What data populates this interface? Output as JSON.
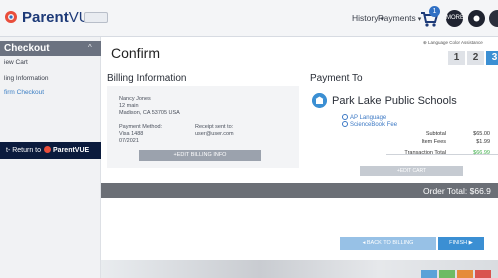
{
  "header": {
    "logo_bold": "Parent",
    "logo_light": "VUE",
    "nav": [
      {
        "label": "History"
      },
      {
        "label": "Payments"
      }
    ],
    "cart_count": "1",
    "nav_caret": "▾",
    "round_btn_label": "MORE"
  },
  "sidebar": {
    "title": "Checkout",
    "caret": "^",
    "items": [
      {
        "label": "iew Cart"
      },
      {
        "label": "ling Information"
      },
      {
        "label": "firm Checkout"
      }
    ],
    "return_prefix": "t- Return to",
    "return_brand": "ParentVUE"
  },
  "main": {
    "title": "Confirm",
    "language_strip": "⊕ Language  Color Assistance",
    "steps": [
      "1",
      "2",
      "3"
    ],
    "current_step": 3
  },
  "billing": {
    "heading": "Billing Information",
    "name": "Nancy Jones",
    "street": "12 main",
    "city_line": "Madison, CA  53705  USA",
    "payment_method_label": "Payment Method:",
    "card": "Visa 1488",
    "expiry": "07/2021",
    "receipt_label": "Receipt sent to:",
    "receipt_email": "user@user.com",
    "edit_label": "+EDIT BILLING INFO"
  },
  "payment_to": {
    "heading": "Payment To",
    "school": "Park Lake Public Schools",
    "items": [
      {
        "label": "AP Language"
      },
      {
        "label": "ScienceBook Fee"
      }
    ],
    "subtotal_label": "Subtotal",
    "subtotal_value": "$65.00",
    "item_fees_label": "Item Fees",
    "item_fees_value": "$1.99",
    "transaction_total_label": "Transaction Total",
    "transaction_total_value": "$66.99",
    "edit_cart_label": "+EDIT CART"
  },
  "order": {
    "total_label": "Order Total: $66.9"
  },
  "actions": {
    "back_label": "◂ BACK TO BILLING",
    "finish_label": "FINISH ▶"
  },
  "colors": {
    "accent": "#3b8fd3",
    "navy": "#0b1b3d",
    "success": "#3fae49"
  }
}
